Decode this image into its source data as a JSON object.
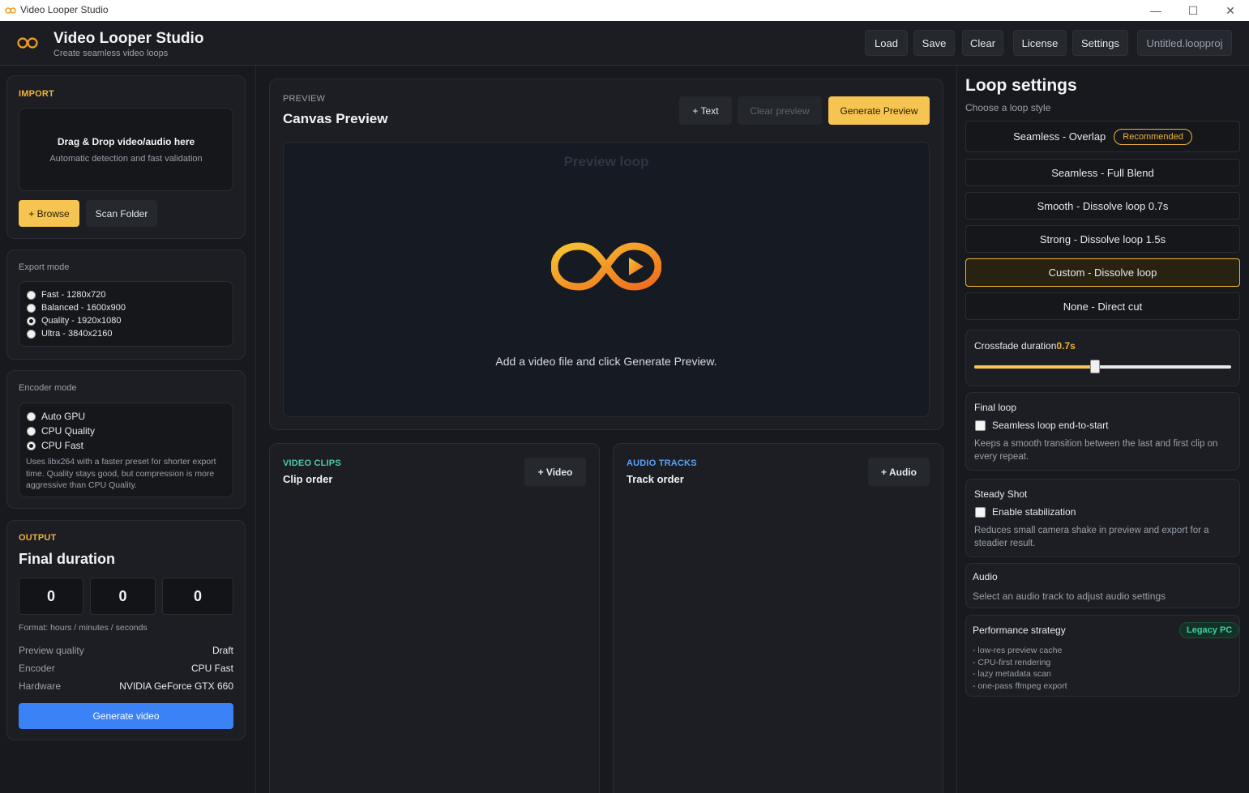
{
  "window": {
    "title": "Video Looper Studio"
  },
  "header": {
    "title": "Video Looper Studio",
    "subtitle": "Create seamless video loops",
    "buttons": {
      "load": "Load",
      "save": "Save",
      "clear": "Clear",
      "license": "License",
      "settings": "Settings"
    },
    "project_name": "Untitled.loopproj"
  },
  "import": {
    "kicker": "IMPORT",
    "drop_title": "Drag & Drop video/audio here",
    "drop_sub": "Automatic detection and fast validation",
    "browse": "+ Browse",
    "scan": "Scan Folder"
  },
  "export_mode": {
    "label": "Export mode",
    "options": [
      "Fast - 1280x720",
      "Balanced - 1600x900",
      "Quality - 1920x1080",
      "Ultra - 3840x2160"
    ],
    "selected": "Quality - 1920x1080"
  },
  "encoder_mode": {
    "label": "Encoder mode",
    "options": [
      "Auto GPU",
      "CPU Quality",
      "CPU Fast"
    ],
    "selected": "CPU Fast",
    "description": "Uses libx264 with a faster preset for shorter export time. Quality stays good, but compression is more aggressive than CPU Quality."
  },
  "output": {
    "kicker": "OUTPUT",
    "title": "Final duration",
    "hours": "0",
    "minutes": "0",
    "seconds": "0",
    "format_hint": "Format: hours / minutes / seconds",
    "rows": [
      {
        "k": "Preview quality",
        "v": "Draft"
      },
      {
        "k": "Encoder",
        "v": "CPU Fast"
      },
      {
        "k": "Hardware",
        "v": "NVIDIA GeForce GTX 660"
      }
    ],
    "generate": "Generate video"
  },
  "preview": {
    "kicker": "PREVIEW",
    "title": "Canvas Preview",
    "text_btn": "+ Text",
    "clear_btn": "Clear preview",
    "generate_btn": "Generate Preview",
    "canvas_label": "Preview loop",
    "hint": "Add a video file and click Generate Preview."
  },
  "clips": {
    "kicker": "VIDEO CLIPS",
    "title": "Clip order",
    "add": "+ Video"
  },
  "tracks": {
    "kicker": "AUDIO TRACKS",
    "title": "Track order",
    "add": "+ Audio"
  },
  "loop": {
    "title": "Loop settings",
    "subtitle": "Choose a loop style",
    "options": [
      {
        "label": "Seamless - Overlap",
        "badge": "Recommended"
      },
      {
        "label": "Seamless - Full Blend"
      },
      {
        "label": "Smooth - Dissolve loop 0.7s"
      },
      {
        "label": "Strong - Dissolve loop 1.5s"
      },
      {
        "label": "Custom - Dissolve loop"
      },
      {
        "label": "None - Direct cut"
      }
    ],
    "selected": "Custom - Dissolve loop",
    "crossfade_label": "Crossfade duration",
    "crossfade_value": "0.7s",
    "crossfade_fraction": 0.47,
    "final_loop": {
      "title": "Final loop",
      "checkbox": "Seamless loop end-to-start",
      "desc": "Keeps a smooth transition between the last and first clip on every repeat."
    },
    "steady": {
      "title": "Steady Shot",
      "checkbox": "Enable stabilization",
      "desc": "Reduces small camera shake in preview and export for a steadier result."
    },
    "audio": {
      "title": "Audio",
      "desc": "Select an audio track to adjust audio settings"
    },
    "performance": {
      "title": "Performance strategy",
      "badge": "Legacy PC",
      "items": [
        "- low-res preview cache",
        "- CPU-first rendering",
        "- lazy metadata scan",
        "- one-pass ffmpeg export"
      ]
    }
  },
  "colors": {
    "accent": "#f5c451",
    "primary_blue": "#3b82f6",
    "teal": "#4fc9b0",
    "link_blue": "#5aa2f5",
    "legacy_green": "#3ad29f"
  }
}
